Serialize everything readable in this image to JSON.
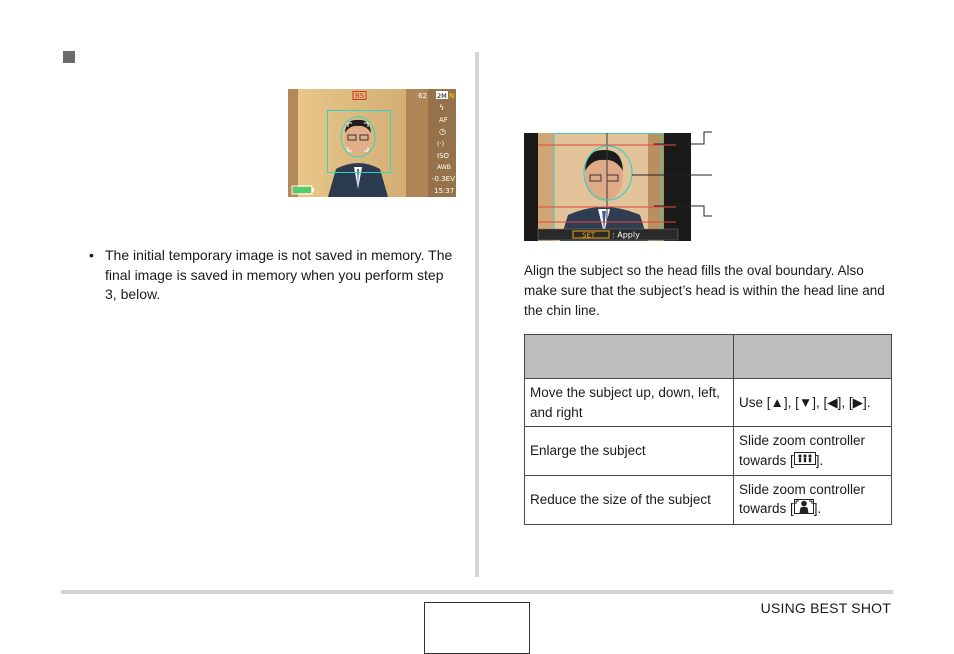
{
  "bullets": [
    "The initial temporary image is not saved in memory. The final image is saved in memory when you perform step 3, below."
  ],
  "camera_screen": {
    "mode_badge": "BS",
    "shots_left": "62",
    "size_label": "2M",
    "quality_label": "N",
    "icons": [
      "ϟ",
      "AF",
      "◷",
      "(·)",
      "ISO",
      "AWB"
    ],
    "ev": "-0.3EV",
    "time": "15:37"
  },
  "align_screen": {
    "set_key": "SET",
    "set_action": ": Apply"
  },
  "description": "Align the subject so the head fills the oval boundary. Also make sure that the subject’s head is within the head line and the chin line.",
  "table": {
    "header": [
      "",
      ""
    ],
    "rows": [
      {
        "action": "Move the subject up, down, left, and right",
        "control": "Use [▲], [▼], [◀], [▶]."
      },
      {
        "action": "Enlarge the subject",
        "control_pre": "Slide zoom controller towards [",
        "control_post": "]."
      },
      {
        "action": "Reduce the size of the subject",
        "control_pre": "Slide zoom controller towards [",
        "control_post": "]."
      }
    ]
  },
  "footer": {
    "section": "USING BEST SHOT"
  }
}
